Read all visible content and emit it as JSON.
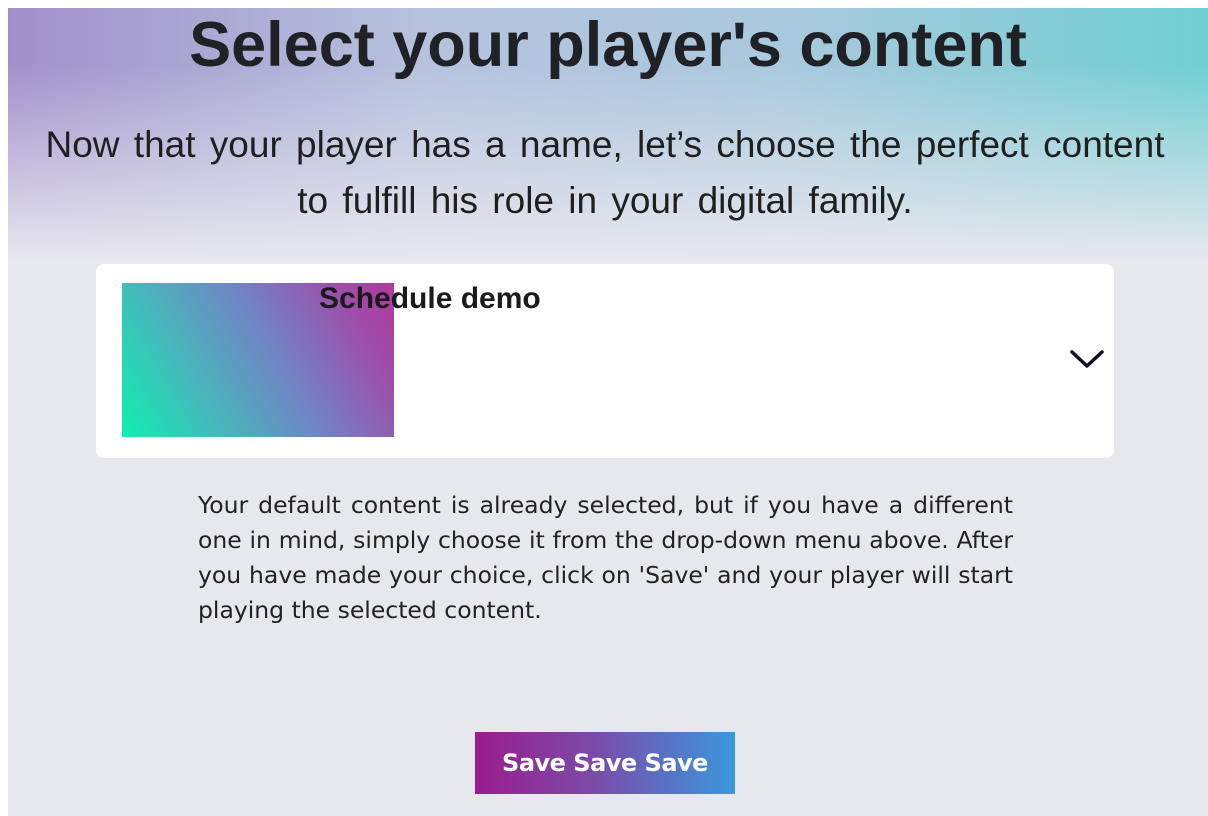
{
  "header": {
    "title": "Select your player's content",
    "subtitle": "Now that your player has a name, let’s choose the perfect content to fulfill his role in your digital family."
  },
  "content_select": {
    "selected_name": "Schedule demo",
    "icon": "chevron-down-icon"
  },
  "description": "Your default content is already selected, but if you have a different one in mind, simply choose it from the drop-down menu above. After you have made your choice, click on 'Save' and your player will start playing the selected content.",
  "actions": {
    "save_label": "Save Save Save"
  },
  "colors": {
    "background": "#e7e7ee",
    "card": "#ffffff",
    "button_gradient_start": "#9b1c8e",
    "button_gradient_end": "#3a98dc",
    "thumbnail_gradient_start": "#0ef0b0",
    "thumbnail_gradient_end": "#b13a9e"
  }
}
